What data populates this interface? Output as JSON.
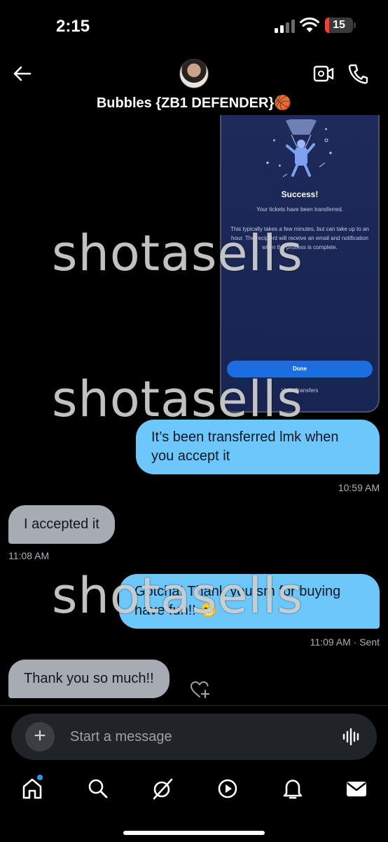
{
  "status_bar": {
    "time": "2:15",
    "battery": "15",
    "battery_fraction": 0.15
  },
  "header": {
    "contact_name": "Bubbles {ZB1 DEFENDER}🏀"
  },
  "attachment": {
    "title": "Success!",
    "subtitle": "Your tickets have been transferred.",
    "body": "This typically takes a few minutes, but can take up to an hour. The recipient will receive an email and notification when the process is complete.",
    "done_label": "Done",
    "view_label": "View Transfers"
  },
  "messages": [
    {
      "direction": "outgoing",
      "text": "It’s been transferred lmk when you accept it",
      "meta": "10:59 AM"
    },
    {
      "direction": "incoming",
      "text": "I accepted it",
      "meta": "11:08 AM"
    },
    {
      "direction": "outgoing",
      "text": "Gotcha! Thank you sm for buying have fun!! 😁",
      "meta": "11:09 AM · Sent"
    },
    {
      "direction": "incoming",
      "text": "Thank you so much!!"
    }
  ],
  "composer": {
    "placeholder": "Start a message"
  },
  "nav": {
    "items": [
      "home-icon",
      "search-icon",
      "grok-icon",
      "video-icon",
      "bell-icon",
      "mail-icon"
    ],
    "active": "home-icon"
  },
  "watermark": "shotasells",
  "colors": {
    "outgoing": "#6cc7fb",
    "incoming": "#a7abb3",
    "accent": "#1d9bf0",
    "battery_low": "#ff3b30"
  }
}
